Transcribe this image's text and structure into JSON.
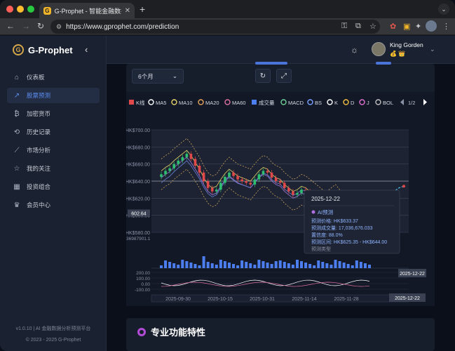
{
  "browser": {
    "tab_title": "G-Prophet - 智能金融数据分析平台",
    "favicon_letter": "G",
    "url": "https://www.gprophet.com/prediction"
  },
  "brand": {
    "name": "G-Prophet",
    "logo_letter": "G"
  },
  "sidebar": {
    "items": [
      {
        "label": "仪表板",
        "icon": "dashboard-icon",
        "active": false
      },
      {
        "label": "股票预测",
        "icon": "trend-icon",
        "active": true
      },
      {
        "label": "加密货币",
        "icon": "bitcoin-icon",
        "active": false
      },
      {
        "label": "历史记录",
        "icon": "history-icon",
        "active": false
      },
      {
        "label": "市场分析",
        "icon": "chart-line-icon",
        "active": false
      },
      {
        "label": "我的关注",
        "icon": "star-icon",
        "active": false
      },
      {
        "label": "投资组合",
        "icon": "portfolio-icon",
        "active": false
      },
      {
        "label": "会员中心",
        "icon": "crown-icon",
        "active": false
      }
    ],
    "footer_version": "v1.0.10 | AI 金融数据分析预测平台",
    "footer_copyright": "© 2023 - 2025 G-Prophet"
  },
  "header": {
    "user_name": "King Gorden",
    "badges": "💰 👑"
  },
  "controls": {
    "range_value": "6个月"
  },
  "chart_data": {
    "type": "candlestick",
    "legend": [
      "K线",
      "MA5",
      "MA10",
      "MA20",
      "MA60",
      "成交量",
      "MACD",
      "BS",
      "K",
      "D",
      "J",
      "BOL"
    ],
    "legend_colors": [
      "#e0484a",
      "#ffffff",
      "#e6d36a",
      "#e6a35a",
      "#e070a0",
      "#4c7ef0",
      "#6fcf97",
      "#7aa0ff",
      "#ffffff",
      "#f0c040",
      "#e070d0",
      "#c0c0c0"
    ],
    "legend_page": "1/2",
    "y_ticks": [
      "HK$700.00",
      "HK$680.00",
      "HK$660.00",
      "HK$640.00",
      "HK$620.00",
      "HK$600.00",
      "HK$580.00"
    ],
    "y_range": [
      580,
      700
    ],
    "current_price_label": "602.64",
    "x_ticks": [
      "2025-09-30",
      "2025-10-15",
      "2025-10-31",
      "2025-11-14",
      "2025-11-28",
      "2025-12-22"
    ],
    "volume_max_label": "36987901.1",
    "macd_ticks": [
      "200.00",
      "100.00",
      "0.00",
      "-100.00"
    ],
    "closes": [
      648,
      652,
      655,
      660,
      664,
      668,
      672,
      666,
      658,
      650,
      640,
      632,
      628,
      630,
      638,
      645,
      650,
      646,
      642,
      640,
      638,
      636,
      642,
      648,
      652,
      650,
      644,
      640,
      638,
      632,
      628,
      624,
      626,
      630,
      628,
      624,
      620,
      616,
      612,
      610,
      614,
      618,
      612,
      608,
      604,
      606,
      602,
      600,
      604,
      602
    ],
    "forecast": [
      602,
      606,
      612,
      618,
      624,
      628,
      632,
      634
    ],
    "tooltip": {
      "date": "2025-12-22",
      "title": "AI预测",
      "rows": [
        "预测价格: HK$633.37",
        "预测成交量: 17,036,676.033",
        "置信度: 88.0%",
        "预测区间: HK$625.35 - HK$644.00",
        "预测类型"
      ]
    },
    "end_date_label": "2025-12-22"
  },
  "features": {
    "title": "专业功能特性"
  }
}
